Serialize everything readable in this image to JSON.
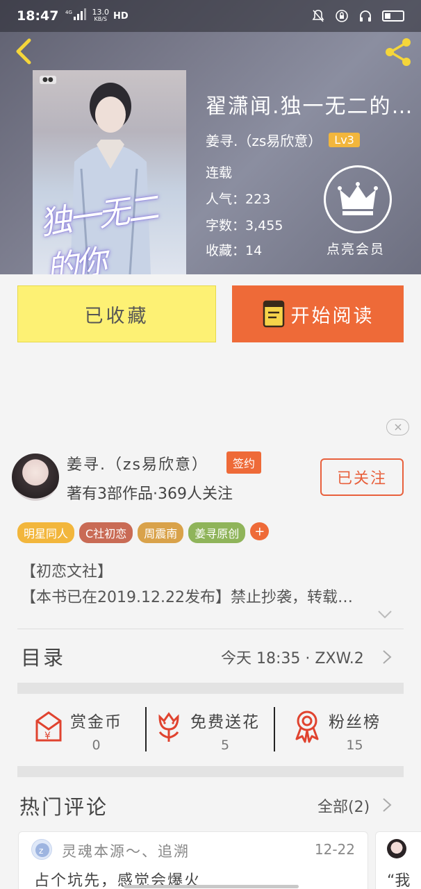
{
  "status_bar": {
    "time": "18:47",
    "network_speed": "13.0",
    "network_unit": "KB/S",
    "hd": "HD"
  },
  "book": {
    "title": "翟潇闻.独一无二的…",
    "author": "姜寻.（zs易欣意）",
    "author_level": "Lv3",
    "status": "连载",
    "popularity_label": "人气：",
    "popularity": "223",
    "word_count_label": "字数：",
    "word_count": "3,455",
    "favorites_label": "收藏：",
    "favorites": "14",
    "cover_title_art": "独一无二的你"
  },
  "vip": {
    "label": "点亮会员"
  },
  "actions": {
    "favorited_label": "已收藏",
    "read_label": "开始阅读"
  },
  "author_card": {
    "name": "姜寻.（zs易欣意）",
    "badge": "签约",
    "stats": "著有3部作品·369人关注",
    "follow_label": "已关注"
  },
  "tags": [
    {
      "label": "明星同人",
      "color": "#f2b63c"
    },
    {
      "label": "C社初恋",
      "color": "#c96b55"
    },
    {
      "label": "周震南",
      "color": "#d9a24a"
    },
    {
      "label": "姜寻原创",
      "color": "#8fb45a"
    }
  ],
  "tag_add": "+",
  "description": {
    "line1": "【初恋文社】",
    "line2": "【本书已在2019.12.22发布】禁止抄袭，转载…"
  },
  "toc": {
    "title": "目录",
    "latest": "今天 18:35 · ZXW.2"
  },
  "stats": {
    "coins_label": "赏金币",
    "coins_value": "0",
    "flowers_label": "免费送花",
    "flowers_value": "5",
    "fans_label": "粉丝榜",
    "fans_value": "15"
  },
  "hot_comments": {
    "title": "热门评论",
    "all_label": "全部(2)",
    "items": [
      {
        "user": "灵魂本源～、追溯",
        "date": "12-22",
        "text": "占个坑先，感觉会爆火"
      },
      {
        "text": "“我"
      }
    ]
  },
  "colors": {
    "accent": "#ee6a38",
    "favorite_bg": "#fdf174",
    "level_badge": "#f2b63c"
  }
}
